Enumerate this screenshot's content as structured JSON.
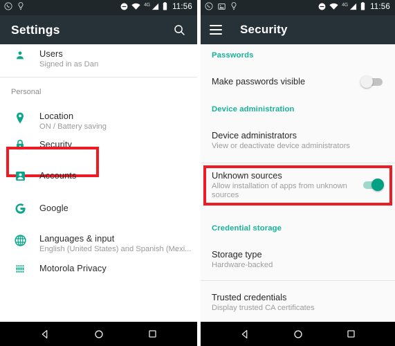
{
  "left_phone": {
    "status_bar": {
      "icons": [
        "whatsapp-icon",
        "lightbulb-icon"
      ],
      "right_icons": [
        "do-not-disturb-icon",
        "wifi-icon",
        "signal-icon",
        "battery-icon"
      ],
      "network_label": "4G",
      "time": "11:56"
    },
    "app_bar": {
      "title": "Settings",
      "search_icon": "search-icon"
    },
    "rows": [
      {
        "icon": "person-icon",
        "title": "Users",
        "subtitle": "Signed in as Dan"
      }
    ],
    "section_label": "Personal",
    "personal_rows": [
      {
        "icon": "location-pin-icon",
        "title": "Location",
        "subtitle": "ON / Battery saving"
      },
      {
        "icon": "lock-icon",
        "title": "Security",
        "subtitle": ""
      },
      {
        "icon": "account-box-icon",
        "title": "Accounts",
        "subtitle": ""
      },
      {
        "icon": "google-g-icon",
        "title": "Google",
        "subtitle": ""
      },
      {
        "icon": "globe-icon",
        "title": "Languages & input",
        "subtitle": "English (United States) and Spanish (Mexi..."
      },
      {
        "icon": "grid-icon",
        "title": "Motorola Privacy",
        "subtitle": ""
      }
    ],
    "highlight_color": "#ed1c24"
  },
  "right_phone": {
    "status_bar": {
      "icons": [
        "whatsapp-icon",
        "screenshot-icon",
        "lightbulb-icon"
      ],
      "right_icons": [
        "do-not-disturb-icon",
        "wifi-icon",
        "signal-icon",
        "battery-icon"
      ],
      "network_label": "4G",
      "time": "11:56"
    },
    "app_bar": {
      "menu_icon": "hamburger-menu-icon",
      "title": "Security"
    },
    "categories": [
      {
        "label": "Passwords"
      },
      {
        "label": "Device administration"
      },
      {
        "label": "Credential storage"
      }
    ],
    "rows": [
      {
        "title": "Make passwords visible",
        "subtitle": "",
        "toggle": "off"
      },
      {
        "title": "Device administrators",
        "subtitle": "View or deactivate device administrators",
        "toggle": null
      },
      {
        "title": "Unknown sources",
        "subtitle": "Allow installation of apps from unknown sources",
        "toggle": "on"
      },
      {
        "title": "Storage type",
        "subtitle": "Hardware-backed",
        "toggle": null
      },
      {
        "title": "Trusted credentials",
        "subtitle": "Display trusted CA certificates",
        "toggle": null
      }
    ],
    "highlight_color": "#ed1c24"
  },
  "nav_bar": {
    "back": "back-triangle-icon",
    "home": "home-circle-icon",
    "recents": "recents-square-icon"
  },
  "theme": {
    "accent_teal": "#14b397",
    "appbar_dark": "#263238",
    "statusbar_dark": "#1f272b",
    "highlight_red": "#ed1c24"
  }
}
